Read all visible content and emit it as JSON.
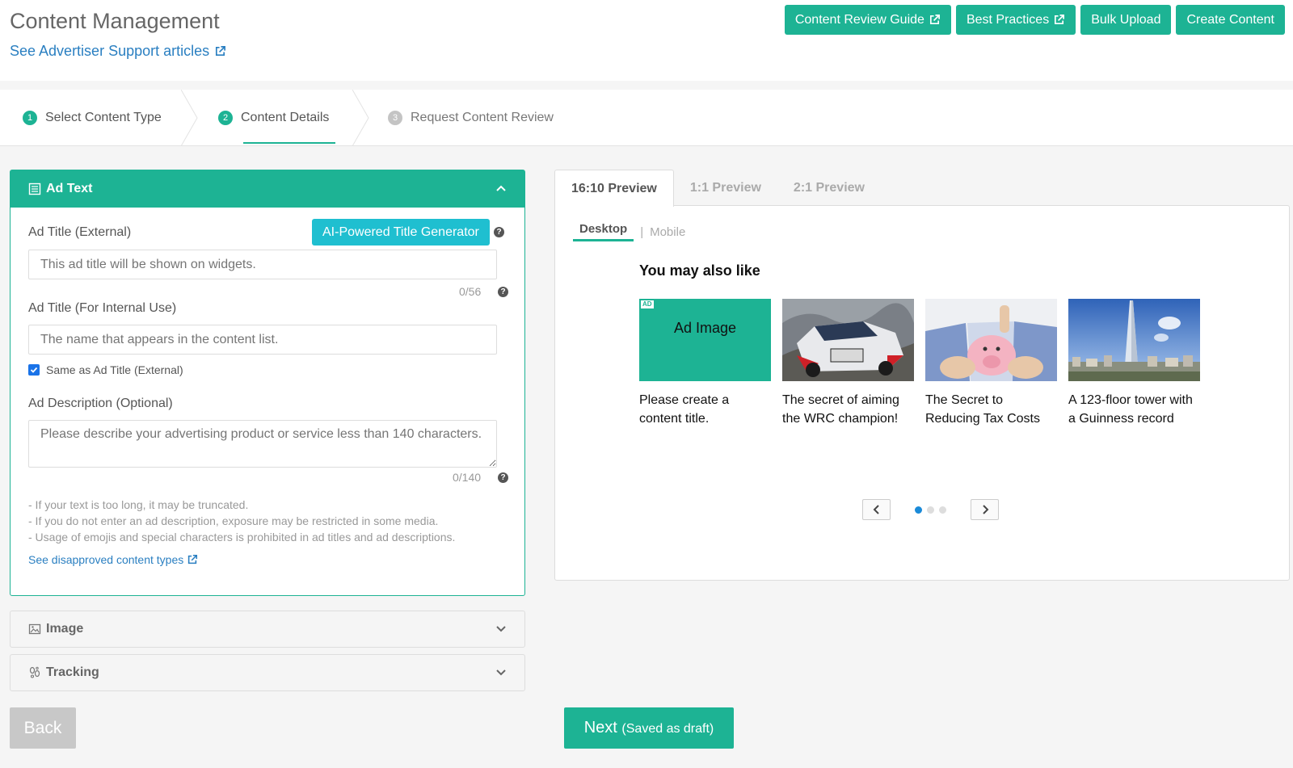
{
  "header": {
    "title": "Content Management",
    "support_link": "See Advertiser Support articles",
    "buttons": [
      "Content Review Guide",
      "Best Practices",
      "Bulk Upload",
      "Create Content"
    ]
  },
  "steps": [
    {
      "num": "1",
      "label": "Select Content Type"
    },
    {
      "num": "2",
      "label": "Content Details"
    },
    {
      "num": "3",
      "label": "Request Content Review"
    }
  ],
  "ad_text": {
    "heading": "Ad Text",
    "title_external_label": "Ad Title (External)",
    "ai_button": "AI-Powered Title Generator",
    "title_external_placeholder": "This ad title will be shown on widgets.",
    "title_external_counter": "0/56",
    "title_internal_label": "Ad Title (For Internal Use)",
    "title_internal_placeholder": "The name that appears in the content list.",
    "same_as_label": "Same as Ad Title (External)",
    "description_label": "Ad Description (Optional)",
    "description_placeholder": "Please describe your advertising product or service less than 140 characters.",
    "description_counter": "0/140",
    "notes": [
      "- If your text is too long, it may be truncated.",
      "- If you do not enter an ad description, exposure may be restricted in some media.",
      "- Usage of emojis and special characters is prohibited in ad titles and ad descriptions."
    ],
    "disapproved_link": "See disapproved content types"
  },
  "sections": {
    "image": "Image",
    "tracking": "Tracking"
  },
  "preview": {
    "tabs": [
      "16:10 Preview",
      "1:1 Preview",
      "2:1 Preview"
    ],
    "devices": {
      "desktop": "Desktop",
      "sep": "|",
      "mobile": "Mobile"
    },
    "widget_title": "You may also like",
    "ad_tag": "AD",
    "ad_image_label": "Ad Image",
    "cards": [
      {
        "title": "Please create a content title."
      },
      {
        "title": "The secret of aiming the WRC champion!"
      },
      {
        "title": "The Secret to Reducing Tax Costs"
      },
      {
        "title": "A 123-floor tower with a Guinness record"
      }
    ]
  },
  "footer": {
    "back": "Back",
    "next": "Next",
    "next_sub": "(Saved as draft)"
  },
  "colors": {
    "accent": "#1db394",
    "ai_button": "#1fbfd0",
    "link": "#2a7fc1"
  }
}
